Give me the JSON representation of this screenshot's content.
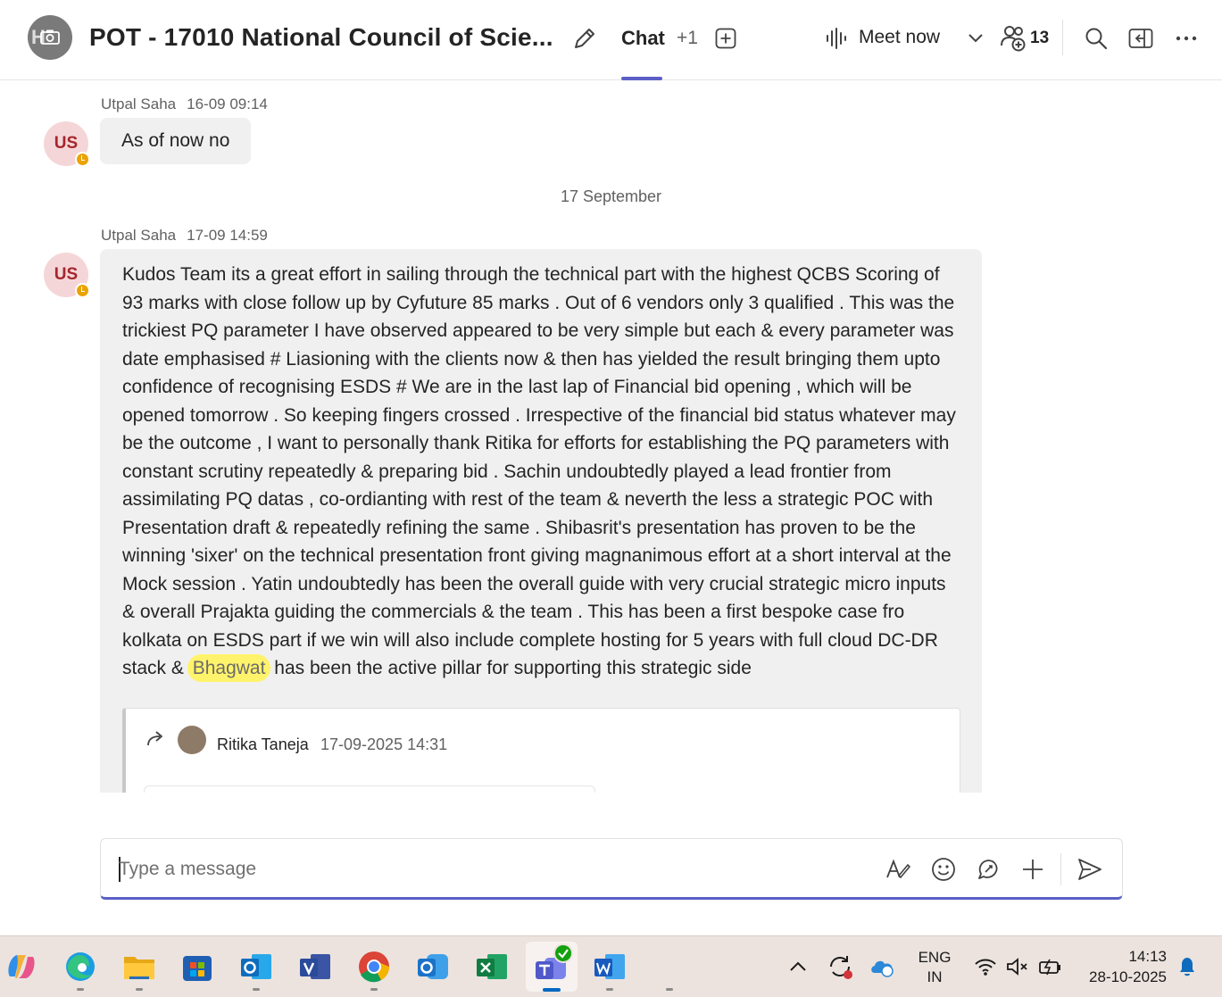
{
  "header": {
    "title": "POT - 17010 National Council of Scie...",
    "group_avatar_text": "H",
    "tab_chat": "Chat",
    "tab_more": "+1",
    "meet_now": "Meet now",
    "participants_count": "13",
    "icons": [
      "edit-icon",
      "add-tab-icon",
      "audio-wave-icon",
      "chevron-down-icon",
      "people-add-icon",
      "search-icon",
      "side-panel-icon",
      "more-icon"
    ],
    "accent_color": "#5b5fc7"
  },
  "messages": [
    {
      "sender": "Utpal Saha",
      "time": "16-09 09:14",
      "initials": "US",
      "text": "As of now no"
    },
    {
      "divider": "17 September"
    },
    {
      "sender": "Utpal Saha",
      "time": "17-09 14:59",
      "initials": "US",
      "text_before": "Kudos Team its a great effort in sailing through the technical part with the highest QCBS Scoring of 93 marks with close follow up by Cyfuture 85 marks . Out of 6 vendors only 3 qualified . This was the trickiest PQ parameter I have observed appeared to be very simple but each & every parameter was date emphasised # Liasioning with the clients now & then has yielded the result bringing them upto confidence of recognising ESDS #  We are in the last lap of Financial bid opening , which will be opened tomorrow . So keeping fingers crossed . Irrespective of the financial bid status whatever may be the outcome , I want to personally thank Ritika  for efforts for establishing the PQ parameters with constant scrutiny repeatedly & preparing bid . Sachin undoubtedly played a lead frontier from assimilating PQ datas , co-ordianting with rest of the team & neverth the less a strategic POC with Presentation draft & repeatedly refining the same  . Shibasrit's presentation has proven to be the winning 'sixer' on the technical presentation front giving magnanimous effort at a short interval at the Mock session . Yatin undoubtedly has been the overall guide with very crucial strategic micro inputs & overall Prajakta guiding the commercials & the team . This has been a first bespoke case fro kolkata on ESDS part  if we win will also include complete hosting for 5 years with full cloud DC-DR stack & ",
      "highlighted": "Bhagwat",
      "text_after": " has been the active pillar for supporting this strategic side",
      "forwarded": {
        "name": "Ritika Taneja",
        "time": "17-09-2025 14:31"
      }
    }
  ],
  "compose": {
    "placeholder": "Type a message",
    "icons": [
      "format-icon",
      "emoji-icon",
      "loop-icon",
      "plus-icon",
      "send-icon"
    ]
  },
  "taskbar": {
    "apps": [
      "copilot-icon",
      "edge-icon",
      "file-explorer-icon",
      "microsoft-store-icon",
      "outlook-icon",
      "visio-icon",
      "chrome-icon",
      "outlook-new-icon",
      "excel-icon",
      "teams-icon",
      "word-icon"
    ],
    "lang_line1": "ENG",
    "lang_line2": "IN",
    "time": "14:13",
    "date": "28-10-2025"
  }
}
